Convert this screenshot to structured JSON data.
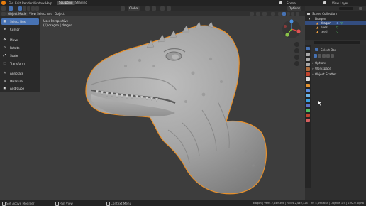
{
  "menu": {
    "items": [
      "File",
      "Edit",
      "Render",
      "Window",
      "Help"
    ],
    "workspace_tabs": [
      "Sculpting",
      "Shading"
    ],
    "scene_label": "Scene",
    "view_layer_label": "View Layer"
  },
  "header": {
    "mode": "Object Mode",
    "view": "View",
    "select": "Select",
    "add": "Add",
    "object": "Object",
    "transform_orientation": "Global",
    "options": "Options"
  },
  "tools": [
    {
      "label": "Select Box",
      "icon": "select-box-icon",
      "active": true
    },
    {
      "label": "Cursor",
      "icon": "cursor-icon",
      "active": false
    },
    {
      "label": "Move",
      "icon": "move-icon",
      "active": false
    },
    {
      "label": "Rotate",
      "icon": "rotate-icon",
      "active": false
    },
    {
      "label": "Scale",
      "icon": "scale-icon",
      "active": false
    },
    {
      "label": "Transform",
      "icon": "transform-icon",
      "active": false
    },
    {
      "label": "Annotate",
      "icon": "annotate-icon",
      "active": false
    },
    {
      "label": "Measure",
      "icon": "measure-icon",
      "active": false
    },
    {
      "label": "Add Cube",
      "icon": "add-cube-icon",
      "active": false
    }
  ],
  "viewport": {
    "perspective": "User Perspective",
    "object_info": "(1) dragon | dragon",
    "axis_labels": [
      "X",
      "Y",
      "Z"
    ]
  },
  "outliner": {
    "title": "Scene Collection",
    "rows": [
      {
        "label": "Dragon",
        "depth": 0
      },
      {
        "label": "dragon",
        "depth": 1,
        "selected": true
      },
      {
        "label": "eyes",
        "depth": 1
      },
      {
        "label": "teeth",
        "depth": 1
      }
    ]
  },
  "properties": {
    "tool_name": "Select Box",
    "sections": [
      "Options",
      "Workspace",
      "Object Scatter"
    ]
  },
  "status": {
    "left": "Set Active Modifier",
    "middle": "Pan View",
    "right_hint": "Context Menu",
    "stats": "dragon | Verts 2,449,366 | Faces 2,449,324 | Tris 4,898,648 | Objects 1/3 | 2.92.0 Alpha"
  },
  "colors": {
    "accent": "#4772b3",
    "selection_outline": "#e8902a",
    "background": "#3d3d3d"
  }
}
